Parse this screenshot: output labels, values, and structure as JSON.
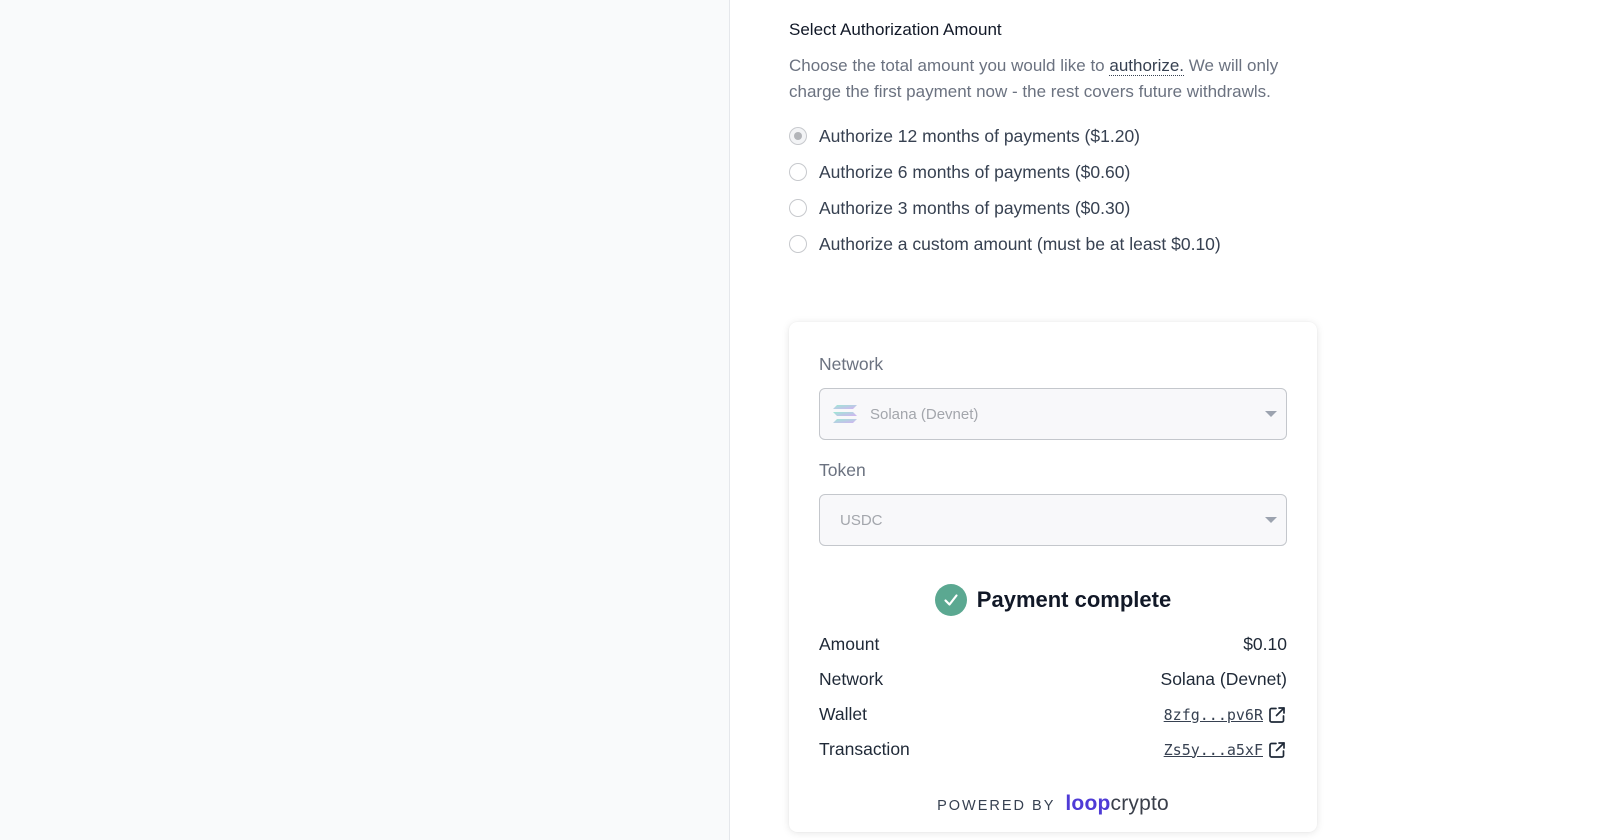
{
  "authorization": {
    "title": "Select Authorization Amount",
    "description_before": "Choose the total amount you would like to ",
    "description_term": "authorize.",
    "description_after": " We will only charge the first payment now - the rest covers future withdrawls.",
    "options": [
      {
        "label": "Authorize 12 months of payments ($1.20)",
        "selected": true
      },
      {
        "label": "Authorize 6 months of payments ($0.60)",
        "selected": false
      },
      {
        "label": "Authorize 3 months of payments ($0.30)",
        "selected": false
      },
      {
        "label": "Authorize a custom amount (must be at least $0.10)",
        "selected": false
      }
    ]
  },
  "payment": {
    "network_label": "Network",
    "network_value": "Solana (Devnet)",
    "token_label": "Token",
    "token_value": "USDC",
    "status": "Payment complete",
    "details": [
      {
        "key": "Amount",
        "value": "$0.10"
      },
      {
        "key": "Network",
        "value": "Solana (Devnet)"
      },
      {
        "key": "Wallet",
        "value": "8zfg...pv6R"
      },
      {
        "key": "Transaction",
        "value": "Zs5y...a5xF"
      }
    ]
  },
  "footer": {
    "powered_by": "POWERED BY",
    "brand_loop": "loop",
    "brand_crypto": "crypto"
  },
  "colors": {
    "success": "#5ba891",
    "brand": "#4f3bd6",
    "left_background": "#f9fafb"
  },
  "icons": {
    "network": "solana-logo-icon",
    "success": "check-circle-icon",
    "external": "external-link-icon"
  }
}
